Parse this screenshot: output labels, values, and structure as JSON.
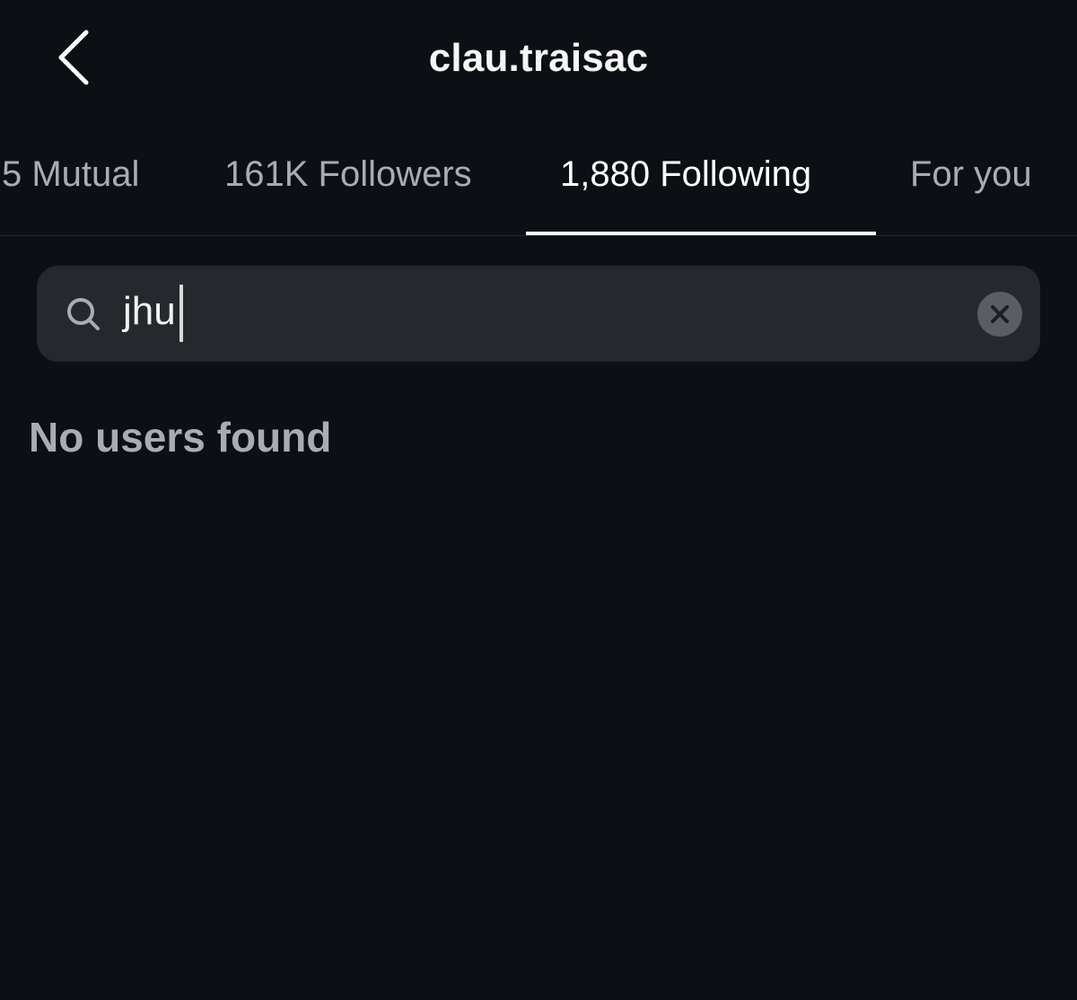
{
  "header": {
    "title": "clau.traisac",
    "back_icon": "chevron-left-icon"
  },
  "tabs": [
    {
      "label": "5 Mutual",
      "active": false
    },
    {
      "label": "161K Followers",
      "active": false
    },
    {
      "label": "1,880 Following",
      "active": true
    },
    {
      "label": "For you",
      "active": false
    }
  ],
  "search": {
    "icon": "search-icon",
    "value": "jhu",
    "clear_icon": "close-icon"
  },
  "results": {
    "empty_message": "No users found"
  },
  "colors": {
    "background": "#0c1014",
    "search_bg": "#25292e",
    "inactive_text": "#a8adb4",
    "active_text": "#ffffff"
  }
}
